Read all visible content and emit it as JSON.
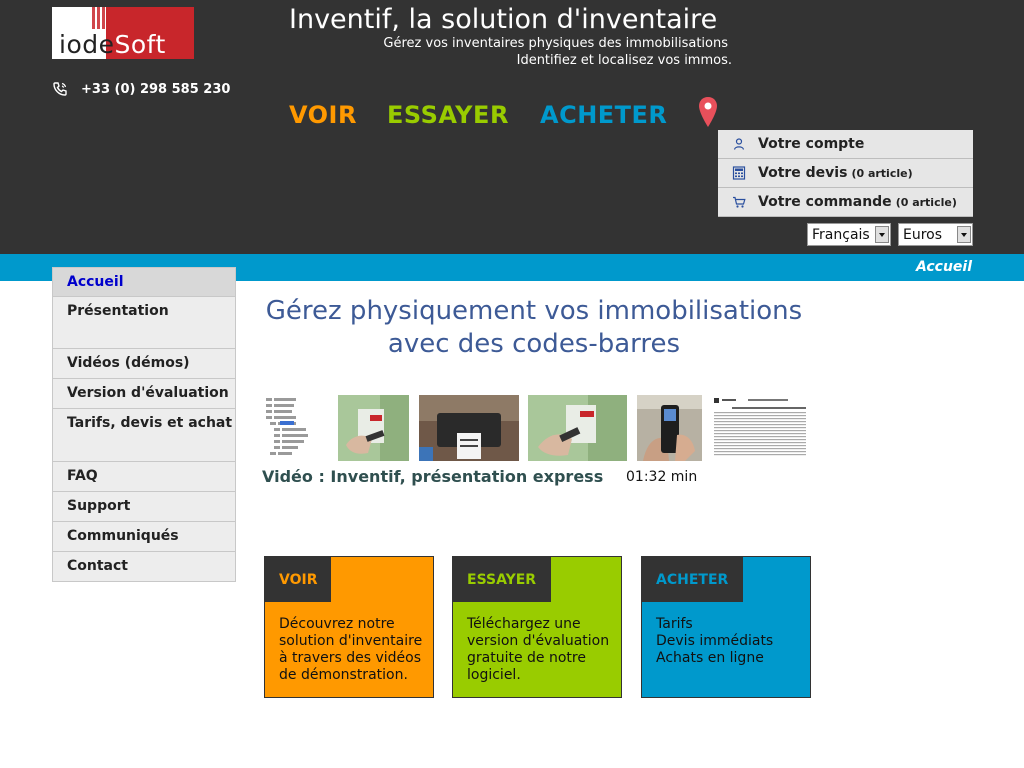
{
  "logo": {
    "part1": "io",
    "part2": "de",
    "part3": "Soft"
  },
  "header": {
    "phone": "+33 (0) 298 585 230",
    "title": "Inventif, la solution d'inventaire",
    "tagline_1": "Gérez vos inventaires physiques des immobilisations",
    "tagline_2": "Identifiez et localisez vos immos."
  },
  "main_nav": {
    "voir": "VOIR",
    "essayer": "ESSAYER",
    "acheter": "ACHETER"
  },
  "account": {
    "compte": "Votre compte",
    "devis": "Votre devis",
    "devis_count": "(0 article)",
    "commande": "Votre commande",
    "commande_count": "(0 article)"
  },
  "selects": {
    "language": "Français",
    "currency": "Euros"
  },
  "breadcrumb": "Accueil",
  "sidebar": {
    "items": [
      {
        "label": "Accueil"
      },
      {
        "label": "Présentation"
      },
      {
        "label": "Vidéos (démos)"
      },
      {
        "label": "Version d'évaluation"
      },
      {
        "label": "Tarifs, devis et achat"
      },
      {
        "label": "FAQ"
      },
      {
        "label": "Support"
      },
      {
        "label": "Communiqués"
      },
      {
        "label": "Contact"
      }
    ]
  },
  "main": {
    "headline": "Gérez physiquement vos immobilisations avec des codes-barres",
    "video_title": "Vidéo : Inventif, présentation express",
    "video_duration": "01:32 min"
  },
  "cards": {
    "voir": {
      "tab": "VOIR",
      "text": "Découvrez notre solution d'inventaire à travers des vidéos de démonstration."
    },
    "essayer": {
      "tab": "ESSAYER",
      "text": "Téléchargez une version d'évaluation gratuite de notre logiciel."
    },
    "acheter": {
      "tab": "ACHETER",
      "lines": [
        "Tarifs",
        "Devis immédiats",
        "Achats en ligne"
      ]
    }
  },
  "colors": {
    "header_bg": "#333333",
    "voir": "#ff9900",
    "essayer": "#99cc00",
    "acheter": "#0099cc",
    "headline": "#3d5a96",
    "active_link": "#0000cc"
  }
}
